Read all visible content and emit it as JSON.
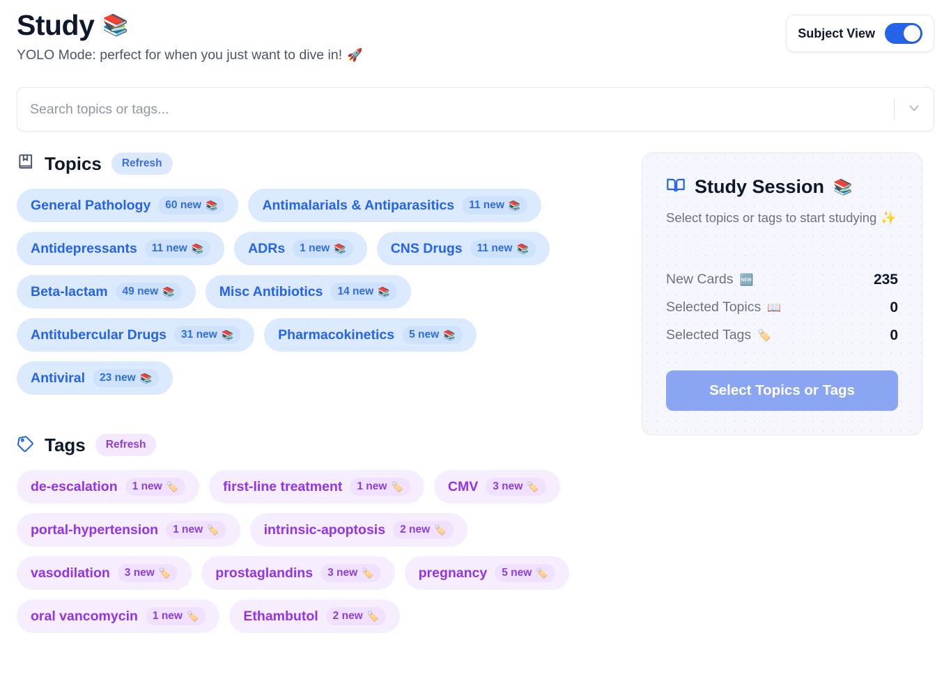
{
  "header": {
    "title": "Study",
    "title_emoji": "📚",
    "subtitle": "YOLO Mode: perfect for when you just want to dive in!",
    "subtitle_emoji": "🚀",
    "subject_view_label": "Subject View",
    "subject_view_state": "on"
  },
  "search": {
    "placeholder": "Search topics or tags...",
    "value": "",
    "chevron_icon": "chevron-down-icon"
  },
  "topics": {
    "section_title": "Topics",
    "section_icon": "book-bookmark-icon",
    "refresh_label": "Refresh",
    "chip_emoji": "📚",
    "items": [
      {
        "label": "General Pathology",
        "count": "60 new"
      },
      {
        "label": "Antimalarials & Antiparasitics",
        "count": "11 new"
      },
      {
        "label": "Antidepressants",
        "count": "11 new"
      },
      {
        "label": "ADRs",
        "count": "1 new"
      },
      {
        "label": "CNS Drugs",
        "count": "11 new"
      },
      {
        "label": "Beta-lactam",
        "count": "49 new"
      },
      {
        "label": "Misc Antibiotics",
        "count": "14 new"
      },
      {
        "label": "Antitubercular Drugs",
        "count": "31 new"
      },
      {
        "label": "Pharmacokinetics",
        "count": "5 new"
      },
      {
        "label": "Antiviral",
        "count": "23 new"
      }
    ]
  },
  "tags": {
    "section_title": "Tags",
    "section_icon": "tag-icon",
    "refresh_label": "Refresh",
    "chip_emoji": "🏷️",
    "items": [
      {
        "label": "de-escalation",
        "count": "1 new"
      },
      {
        "label": "first-line treatment",
        "count": "1 new"
      },
      {
        "label": "CMV",
        "count": "3 new"
      },
      {
        "label": "portal-hypertension",
        "count": "1 new"
      },
      {
        "label": "intrinsic-apoptosis",
        "count": "2 new"
      },
      {
        "label": "vasodilation",
        "count": "3 new"
      },
      {
        "label": "prostaglandins",
        "count": "3 new"
      },
      {
        "label": "pregnancy",
        "count": "5 new"
      },
      {
        "label": "oral vancomycin",
        "count": "1 new"
      },
      {
        "label": "Ethambutol",
        "count": "2 new"
      }
    ]
  },
  "session": {
    "title": "Study Session",
    "title_emoji": "📚",
    "icon": "open-book-icon",
    "subtitle": "Select topics or tags to start studying ✨",
    "stats": [
      {
        "label": "New Cards",
        "emoji": "🆕",
        "value": "235"
      },
      {
        "label": "Selected Topics",
        "emoji": "📖",
        "value": "0"
      },
      {
        "label": "Selected Tags",
        "emoji": "🏷️",
        "value": "0"
      }
    ],
    "button_label": "Select Topics or Tags"
  },
  "colors": {
    "accent_blue": "#2563eb",
    "accent_purple": "#9333ea",
    "chip_blue_bg": "#dbeafe",
    "chip_purple_bg": "#f6eeff",
    "button_blue": "#8aa6f2"
  }
}
